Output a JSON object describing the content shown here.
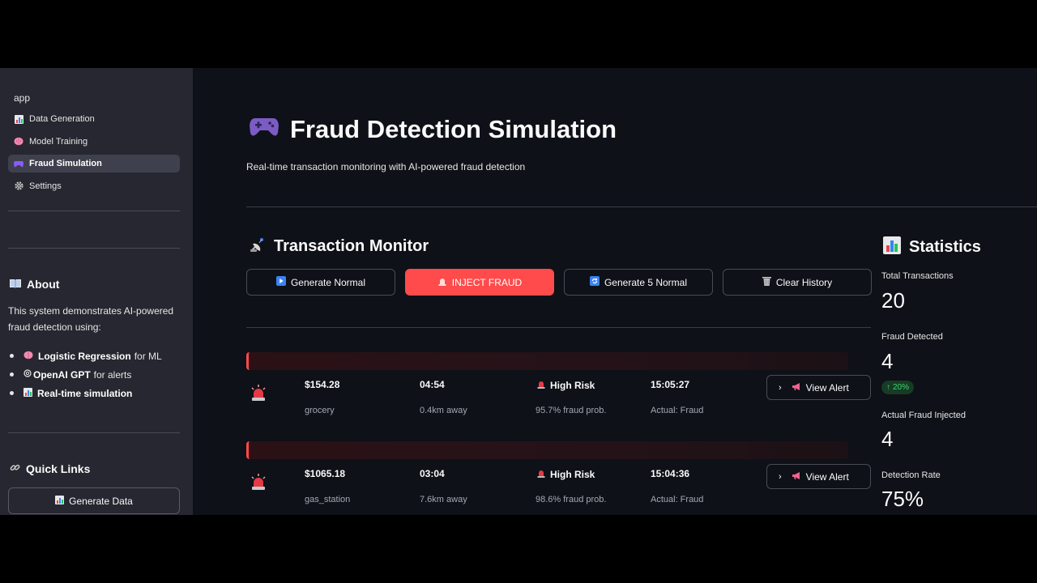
{
  "sidebar": {
    "app_label": "app",
    "nav": [
      {
        "label": "Data Generation",
        "icon": "chart-icon",
        "active": false
      },
      {
        "label": "Model Training",
        "icon": "brain-icon",
        "active": false
      },
      {
        "label": "Fraud Simulation",
        "icon": "gamepad-icon",
        "active": true
      },
      {
        "label": "Settings",
        "icon": "gear-icon",
        "active": false
      }
    ],
    "about": {
      "heading": "About",
      "text": "This system demonstrates AI-powered fraud detection using:",
      "items": [
        {
          "bold": "Logistic Regression",
          "rest": "for ML"
        },
        {
          "bold": "OpenAI GPT",
          "rest": "for alerts"
        },
        {
          "bold": "Real-time simulation",
          "rest": ""
        }
      ]
    },
    "quick_links": {
      "heading": "Quick Links",
      "button": "Generate Data"
    }
  },
  "main": {
    "title": "Fraud Detection Simulation",
    "subtitle": "Real-time transaction monitoring with AI-powered fraud detection",
    "monitor": {
      "heading": "Transaction Monitor",
      "buttons": {
        "generate_normal": "Generate Normal",
        "inject_fraud": "INJECT FRAUD",
        "generate_5": "Generate 5 Normal",
        "clear_history": "Clear History"
      },
      "transactions": [
        {
          "amount": "$154.28",
          "category": "grocery",
          "time": "04:54",
          "distance": "0.4km away",
          "risk": "High Risk",
          "prob": "95.7% fraud prob.",
          "timestamp": "15:05:27",
          "actual": "Actual: Fraud",
          "action": "View Alert"
        },
        {
          "amount": "$1065.18",
          "category": "gas_station",
          "time": "03:04",
          "distance": "7.6km away",
          "risk": "High Risk",
          "prob": "98.6% fraud prob.",
          "timestamp": "15:04:36",
          "actual": "Actual: Fraud",
          "action": "View Alert"
        }
      ]
    },
    "stats": {
      "heading": "Statistics",
      "total_label": "Total Transactions",
      "total_value": "20",
      "fraud_label": "Fraud Detected",
      "fraud_value": "4",
      "fraud_delta": "20%",
      "actual_label": "Actual Fraud Injected",
      "actual_value": "4",
      "rate_label": "Detection Rate",
      "rate_value": "75%"
    }
  },
  "colors": {
    "accent": "#ff4b4b",
    "sidebar_bg": "#262730",
    "main_bg": "#0e1117",
    "delta_green": "#3dd56d"
  }
}
